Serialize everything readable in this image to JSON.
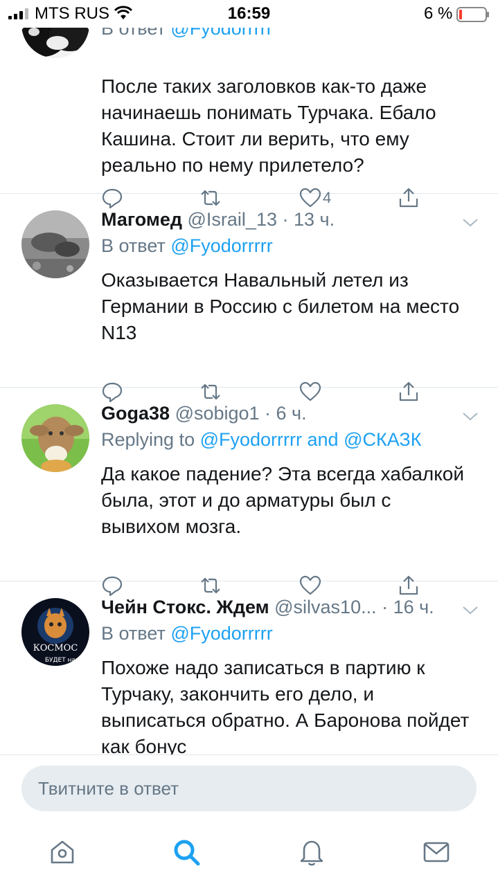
{
  "status_bar": {
    "carrier": "MTS RUS",
    "time": "16:59",
    "battery": "6 %"
  },
  "tweets": [
    {
      "name": "",
      "handle": "",
      "reply_prefix": "В ответ",
      "reply_to": "@Fyodorrrrr",
      "text": "После таких заголовков как-то даже начинаешь понимать Турчака. Ебало Кашина. Стоит ли верить, что ему реально по нему прилетело?",
      "likes": "4"
    },
    {
      "name": "Магомед",
      "handle": "@Israil_13 · 13 ч.",
      "reply_prefix": "В ответ",
      "reply_to": "@Fyodorrrrr",
      "text": "Оказывается Навальный летел из Германии в Россию с билетом на место N13",
      "likes": ""
    },
    {
      "name": "Goga38",
      "handle": "@sobigo1 · 6 ч.",
      "reply_prefix": "Replying to",
      "reply_to": "@Fyodorrrrr and @СКАЗК",
      "text": "Да какое падение? Эта всегда хабалкой была, этот и до арматуры был с вывихом мозга.",
      "likes": ""
    },
    {
      "name": "Чейн Стокс. Ждем",
      "handle": "@silvas10... · 16 ч.",
      "reply_prefix": "В ответ",
      "reply_to": "@Fyodorrrrr",
      "text": "Похоже надо записаться в партию к Турчаку, закончить его дело, и выписаться обратно. А Баронова пойдет как бонус",
      "likes": "",
      "avatar_text_1": "КОСМОС",
      "avatar_text_2": "БУДЕТ наш"
    }
  ],
  "composer": {
    "placeholder": "Твитните в ответ"
  },
  "tabbar": {
    "items": [
      "home-icon",
      "search-icon",
      "notifications-icon",
      "messages-icon"
    ],
    "active": "search-icon"
  },
  "colors": {
    "accent": "#1da1f2",
    "meta": "#657786",
    "text": "#14171a",
    "battery_low": "#ff3b30"
  }
}
